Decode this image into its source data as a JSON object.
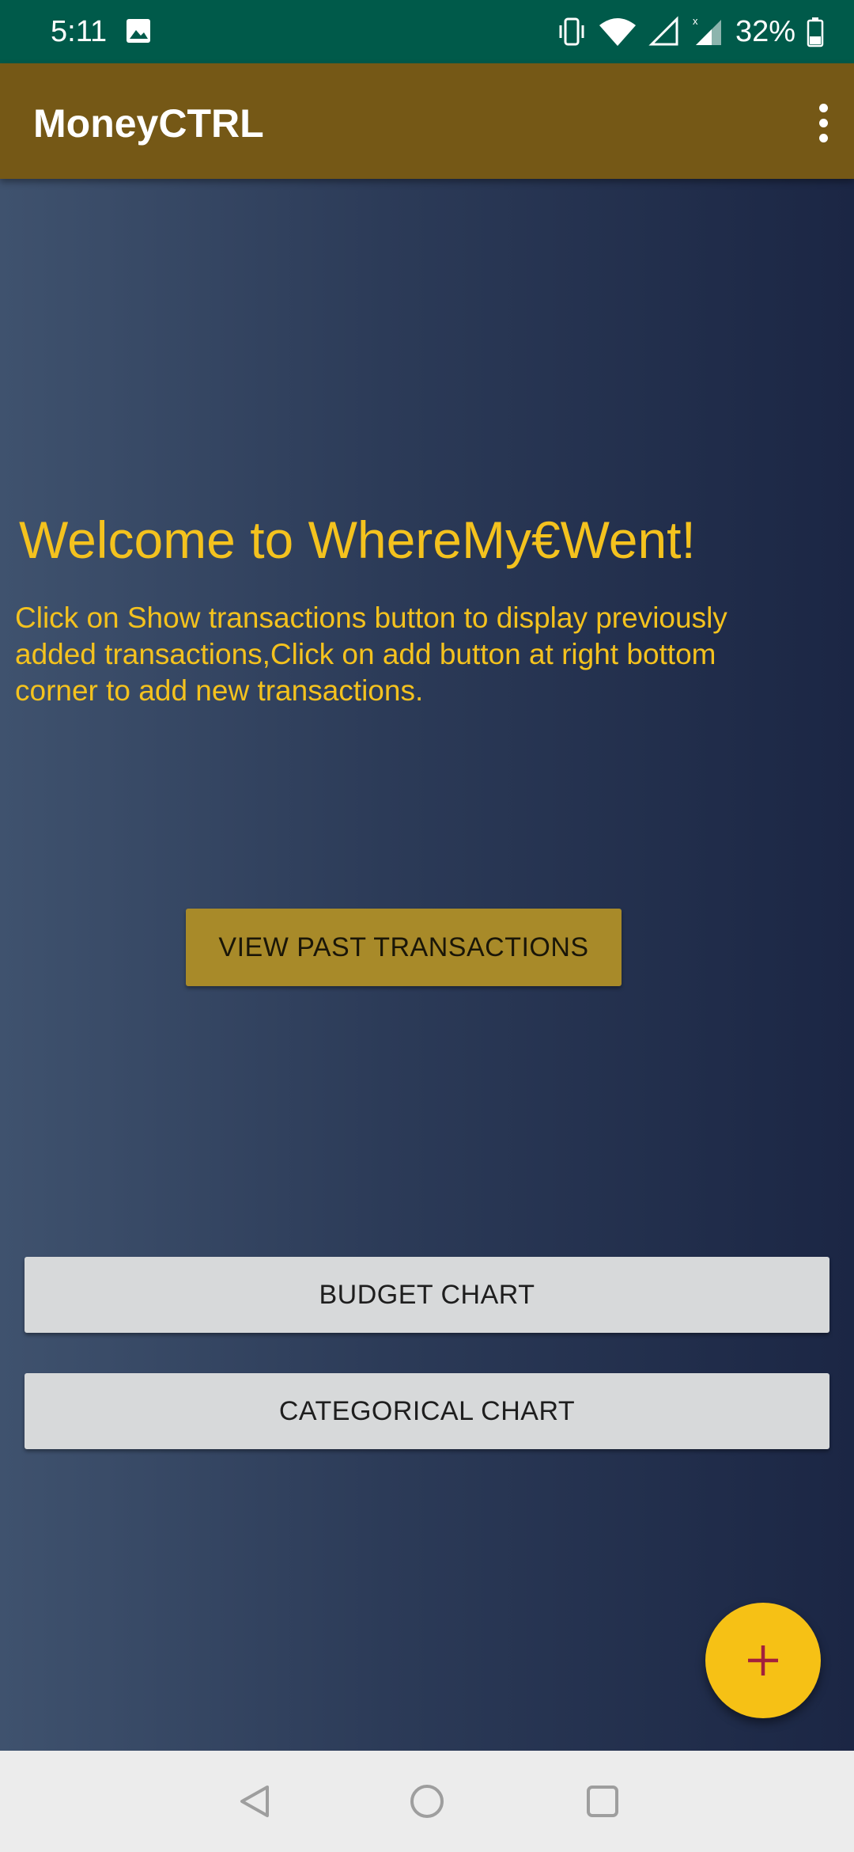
{
  "status_bar": {
    "time": "5:11",
    "battery_percent": "32%",
    "icons": [
      "image-icon",
      "vibrate-icon",
      "wifi-icon",
      "signal-icon",
      "signal-x-icon",
      "battery-icon"
    ]
  },
  "app_bar": {
    "title": "MoneyCTRL",
    "menu_icon": "overflow-menu-icon"
  },
  "main": {
    "welcome_title": "Welcome to WhereMy€Went!",
    "instructions": "Click on Show transactions button to display previously added transactions,Click on add button at right bottom corner to add new transactions.",
    "view_past_label": "VIEW PAST TRANSACTIONS",
    "budget_chart_label": "BUDGET CHART",
    "categorical_chart_label": "CATEGORICAL CHART",
    "fab_icon": "plus-icon"
  },
  "nav_bar": {
    "buttons": [
      "back-icon",
      "home-icon",
      "recents-icon"
    ]
  },
  "colors": {
    "status_bar": "#005a4a",
    "app_bar": "#755816",
    "accent_text": "#f4c21e",
    "primary_button": "#a88a29",
    "secondary_button": "#d7d9da",
    "fab": "#f6c115",
    "fab_icon": "#a3213c"
  }
}
